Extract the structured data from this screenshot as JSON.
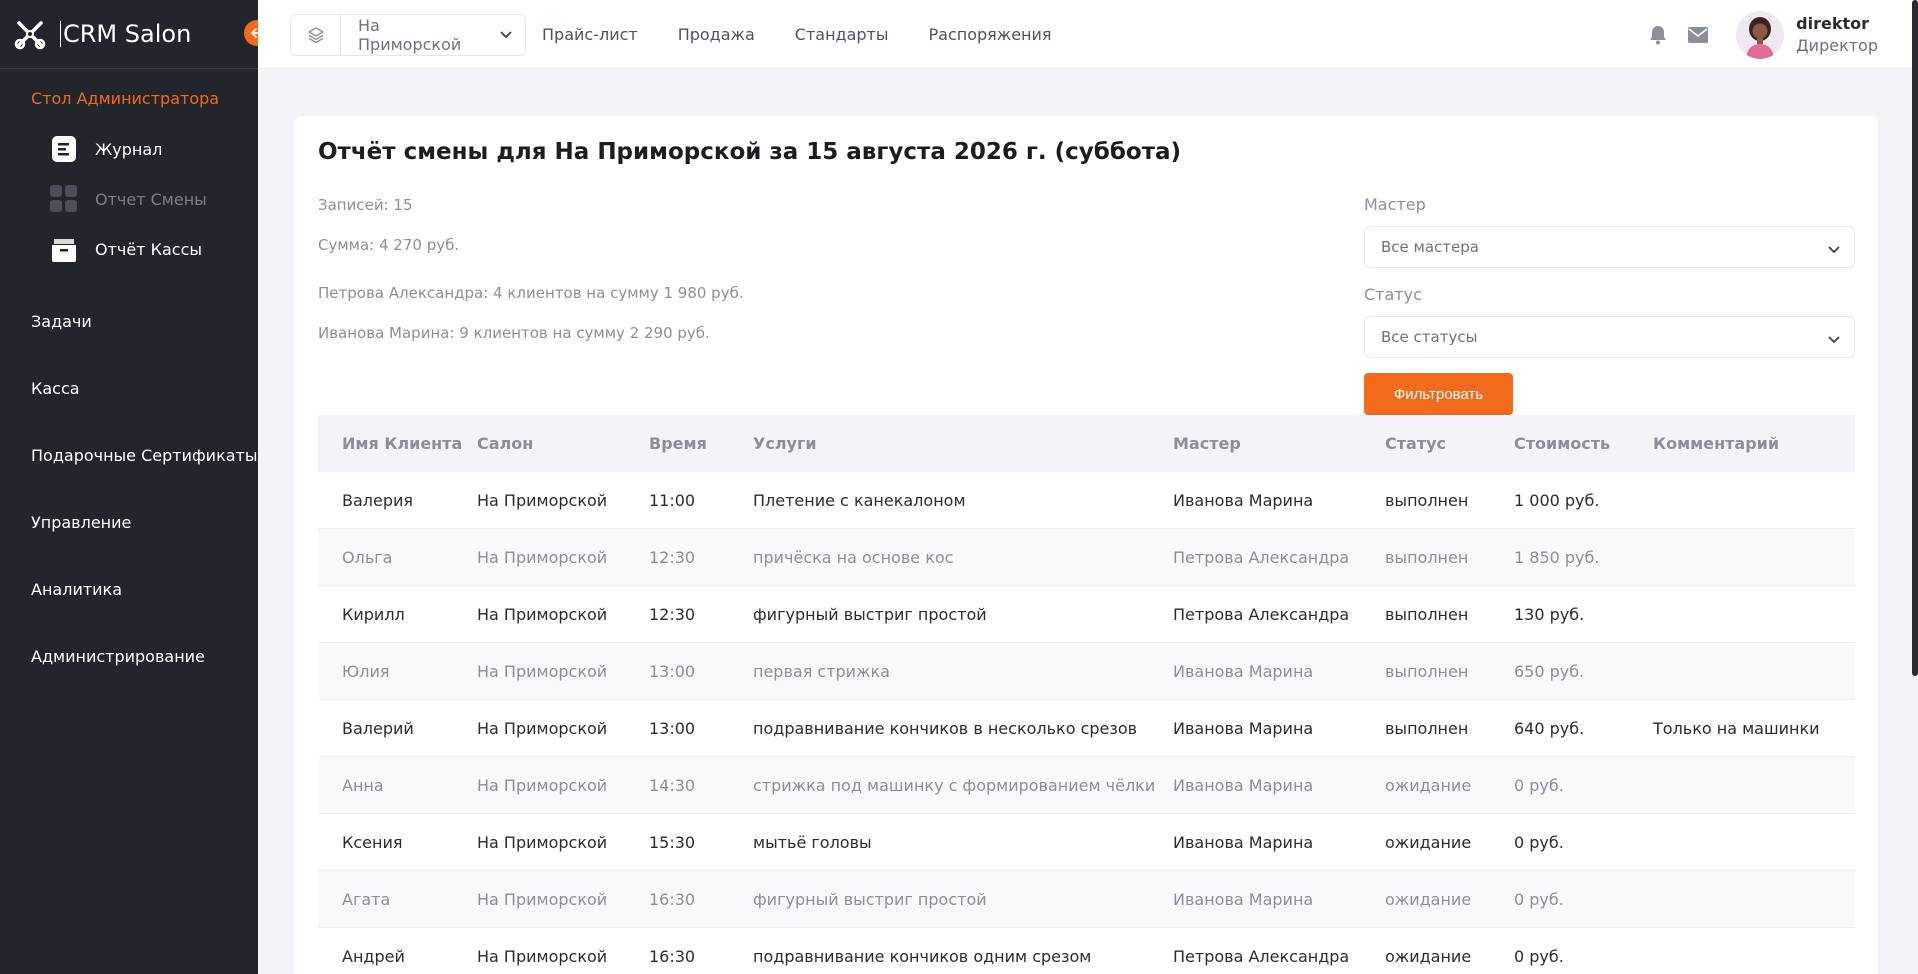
{
  "app": {
    "name": "CRM Salon"
  },
  "colors": {
    "accent": "#f26a1b",
    "sidebar_bg": "#22252c"
  },
  "sidebar": {
    "section_title": "Стол Администратора",
    "sub_items": [
      {
        "label": "Журнал",
        "icon": "journal-icon",
        "active": true
      },
      {
        "label": "Отчет Смены",
        "icon": "grid-icon",
        "active": false
      },
      {
        "label": "Отчёт Кассы",
        "icon": "cash-register-icon",
        "active": true
      }
    ],
    "items": [
      {
        "label": "Задачи"
      },
      {
        "label": "Касса"
      },
      {
        "label": "Подарочные Сертификаты"
      },
      {
        "label": "Управление"
      },
      {
        "label": "Аналитика"
      },
      {
        "label": "Администрирование"
      }
    ]
  },
  "topbar": {
    "branch": "На Приморской",
    "links": [
      "Прайс-лист",
      "Продажа",
      "Стандарты",
      "Распоряжения"
    ],
    "user": {
      "login": "direktor",
      "role": "Директор"
    }
  },
  "report": {
    "title": "Отчёт смены для На Приморской за 15 августа 2026 г. (суббота)",
    "records": "Записей: 15",
    "sum": "Сумма: 4 270 руб.",
    "masters_summary": [
      "Петрова Александра: 4 клиентов на сумму 1 980 руб.",
      "Иванова Марина: 9 клиентов на сумму 2 290 руб."
    ]
  },
  "filters": {
    "master_label": "Мастер",
    "master_value": "Все мастера",
    "status_label": "Статус",
    "status_value": "Все статусы",
    "button": "Фильтровать"
  },
  "table": {
    "headers": [
      "Имя Клиента",
      "Салон",
      "Время",
      "Услуги",
      "Мастер",
      "Статус",
      "Стоимость",
      "Комментарий"
    ],
    "rows": [
      [
        "Валерия",
        "На Приморской",
        "11:00",
        "Плетение с канекалоном",
        "Иванова Марина",
        "выполнен",
        "1 000 руб.",
        ""
      ],
      [
        "Ольга",
        "На Приморской",
        "12:30",
        "причёска на основе кос",
        "Петрова Александра",
        "выполнен",
        "1 850 руб.",
        ""
      ],
      [
        "Кирилл",
        "На Приморской",
        "12:30",
        "фигурный выстриг простой",
        "Петрова Александра",
        "выполнен",
        "130 руб.",
        ""
      ],
      [
        "Юлия",
        "На Приморской",
        "13:00",
        "первая стрижка",
        "Иванова Марина",
        "выполнен",
        "650 руб.",
        ""
      ],
      [
        "Валерий",
        "На Приморской",
        "13:00",
        "подравнивание кончиков в несколько срезов",
        "Иванова Марина",
        "выполнен",
        "640 руб.",
        "Только на машинки"
      ],
      [
        "Анна",
        "На Приморской",
        "14:30",
        "стрижка под машинку с формированием чёлки",
        "Иванова Марина",
        "ожидание",
        "0 руб.",
        ""
      ],
      [
        "Ксения",
        "На Приморской",
        "15:30",
        "мытьё головы",
        "Иванова Марина",
        "ожидание",
        "0 руб.",
        ""
      ],
      [
        "Агата",
        "На Приморской",
        "16:30",
        "фигурный выстриг простой",
        "Иванова Марина",
        "ожидание",
        "0 руб.",
        ""
      ],
      [
        "Андрей",
        "На Приморской",
        "16:30",
        "подравнивание кончиков одним срезом",
        "Петрова Александра",
        "ожидание",
        "0 руб.",
        ""
      ]
    ]
  }
}
